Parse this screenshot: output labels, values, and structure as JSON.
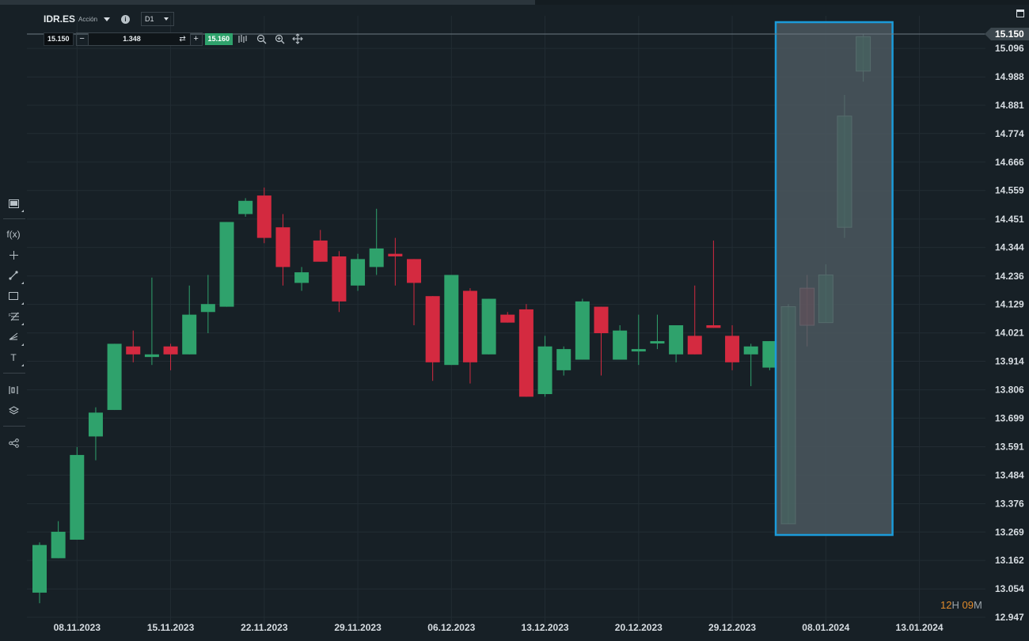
{
  "header": {
    "symbol": "IDR.ES",
    "instrument_type": "Acción",
    "timeframe": "D1"
  },
  "trade": {
    "sell_price": "15.150",
    "quantity": "1.348",
    "buy_price": "15.160",
    "minus_label": "−",
    "plus_label": "+"
  },
  "countdown": {
    "h_value": "12",
    "h_unit": "H",
    "m_value": "09",
    "m_unit": "M"
  },
  "colors": {
    "background": "#172026",
    "grid": "#222c33",
    "up": "#2fa26c",
    "down": "#d42a40",
    "selection_border": "#1b9bd9",
    "selection_fill": "#4b585f",
    "axis_text": "#d7dde2",
    "countdown": "#e08a2c"
  },
  "icons": [
    "chart-type-icon",
    "function-icon",
    "crosshair-icon",
    "trendline-icon",
    "rectangle-icon",
    "fibonacci-icon",
    "pitchfork-icon",
    "text-icon",
    "indicators-icon",
    "layers-icon",
    "share-icon",
    "zoom-out-icon",
    "zoom-in-icon",
    "move-icon",
    "bar-style-icon",
    "info-icon",
    "window-icon",
    "swap-icon"
  ],
  "chart_data": {
    "type": "candlestick",
    "price_ticks": [
      "15.096",
      "14.988",
      "14.881",
      "14.774",
      "14.666",
      "14.559",
      "14.451",
      "14.344",
      "14.236",
      "14.129",
      "14.021",
      "13.914",
      "13.806",
      "13.699",
      "13.591",
      "13.484",
      "13.376",
      "13.269",
      "13.162",
      "13.054",
      "12.947"
    ],
    "current_price": "15.150",
    "date_labels": [
      "08.11.2023",
      "15.11.2023",
      "22.11.2023",
      "29.11.2023",
      "06.12.2023",
      "13.12.2023",
      "20.12.2023",
      "29.12.2023",
      "08.01.2024",
      "13.01.2024"
    ],
    "ylim": [
      12.947,
      15.15
    ],
    "grid": true,
    "candles": [
      {
        "o": 13.04,
        "h": 13.23,
        "l": 13.0,
        "c": 13.22
      },
      {
        "o": 13.17,
        "h": 13.31,
        "l": 13.17,
        "c": 13.27
      },
      {
        "o": 13.24,
        "h": 13.59,
        "l": 13.24,
        "c": 13.56
      },
      {
        "o": 13.63,
        "h": 13.74,
        "l": 13.54,
        "c": 13.72
      },
      {
        "o": 13.73,
        "h": 13.98,
        "l": 13.73,
        "c": 13.98
      },
      {
        "o": 13.97,
        "h": 14.03,
        "l": 13.91,
        "c": 13.94
      },
      {
        "o": 13.93,
        "h": 14.23,
        "l": 13.9,
        "c": 13.94
      },
      {
        "o": 13.97,
        "h": 13.98,
        "l": 13.88,
        "c": 13.94
      },
      {
        "o": 13.94,
        "h": 14.2,
        "l": 13.94,
        "c": 14.09
      },
      {
        "o": 14.1,
        "h": 14.24,
        "l": 14.02,
        "c": 14.13
      },
      {
        "o": 14.12,
        "h": 14.44,
        "l": 14.12,
        "c": 14.44
      },
      {
        "o": 14.47,
        "h": 14.53,
        "l": 14.46,
        "c": 14.52
      },
      {
        "o": 14.54,
        "h": 14.57,
        "l": 14.36,
        "c": 14.38
      },
      {
        "o": 14.42,
        "h": 14.47,
        "l": 14.2,
        "c": 14.27
      },
      {
        "o": 14.21,
        "h": 14.27,
        "l": 14.18,
        "c": 14.25
      },
      {
        "o": 14.37,
        "h": 14.41,
        "l": 14.29,
        "c": 14.29
      },
      {
        "o": 14.31,
        "h": 14.33,
        "l": 14.1,
        "c": 14.14
      },
      {
        "o": 14.2,
        "h": 14.32,
        "l": 14.18,
        "c": 14.3
      },
      {
        "o": 14.27,
        "h": 14.49,
        "l": 14.24,
        "c": 14.34
      },
      {
        "o": 14.32,
        "h": 14.38,
        "l": 14.2,
        "c": 14.31
      },
      {
        "o": 14.3,
        "h": 14.3,
        "l": 14.05,
        "c": 14.21
      },
      {
        "o": 14.16,
        "h": 14.16,
        "l": 13.84,
        "c": 13.91
      },
      {
        "o": 13.9,
        "h": 14.24,
        "l": 13.9,
        "c": 14.24
      },
      {
        "o": 14.18,
        "h": 14.19,
        "l": 13.83,
        "c": 13.91
      },
      {
        "o": 13.94,
        "h": 14.15,
        "l": 13.94,
        "c": 14.15
      },
      {
        "o": 14.09,
        "h": 14.1,
        "l": 14.06,
        "c": 14.06
      },
      {
        "o": 14.11,
        "h": 14.13,
        "l": 13.78,
        "c": 13.78
      },
      {
        "o": 13.79,
        "h": 14.01,
        "l": 13.78,
        "c": 13.97
      },
      {
        "o": 13.88,
        "h": 13.97,
        "l": 13.86,
        "c": 13.96
      },
      {
        "o": 13.92,
        "h": 14.15,
        "l": 13.92,
        "c": 14.14
      },
      {
        "o": 14.12,
        "h": 14.12,
        "l": 13.86,
        "c": 14.02
      },
      {
        "o": 13.92,
        "h": 14.05,
        "l": 13.92,
        "c": 14.03
      },
      {
        "o": 13.96,
        "h": 14.09,
        "l": 13.9,
        "c": 13.96
      },
      {
        "o": 13.99,
        "h": 14.09,
        "l": 13.96,
        "c": 13.99
      },
      {
        "o": 13.94,
        "h": 14.05,
        "l": 13.91,
        "c": 14.05
      },
      {
        "o": 14.01,
        "h": 14.2,
        "l": 13.94,
        "c": 13.94
      },
      {
        "o": 14.05,
        "h": 14.37,
        "l": 14.04,
        "c": 14.04
      },
      {
        "o": 14.01,
        "h": 14.05,
        "l": 13.88,
        "c": 13.91
      },
      {
        "o": 13.94,
        "h": 13.98,
        "l": 13.82,
        "c": 13.97
      },
      {
        "o": 13.89,
        "h": 13.99,
        "l": 13.88,
        "c": 13.99
      },
      {
        "o": 13.3,
        "h": 14.13,
        "l": 13.3,
        "c": 14.12
      },
      {
        "o": 14.19,
        "h": 14.24,
        "l": 13.97,
        "c": 14.05
      },
      {
        "o": 14.06,
        "h": 14.28,
        "l": 14.06,
        "c": 14.24
      },
      {
        "o": 14.42,
        "h": 14.92,
        "l": 14.38,
        "c": 14.84
      },
      {
        "o": 15.01,
        "h": 15.15,
        "l": 14.97,
        "c": 15.14
      }
    ],
    "highlight_start_index": 40
  }
}
